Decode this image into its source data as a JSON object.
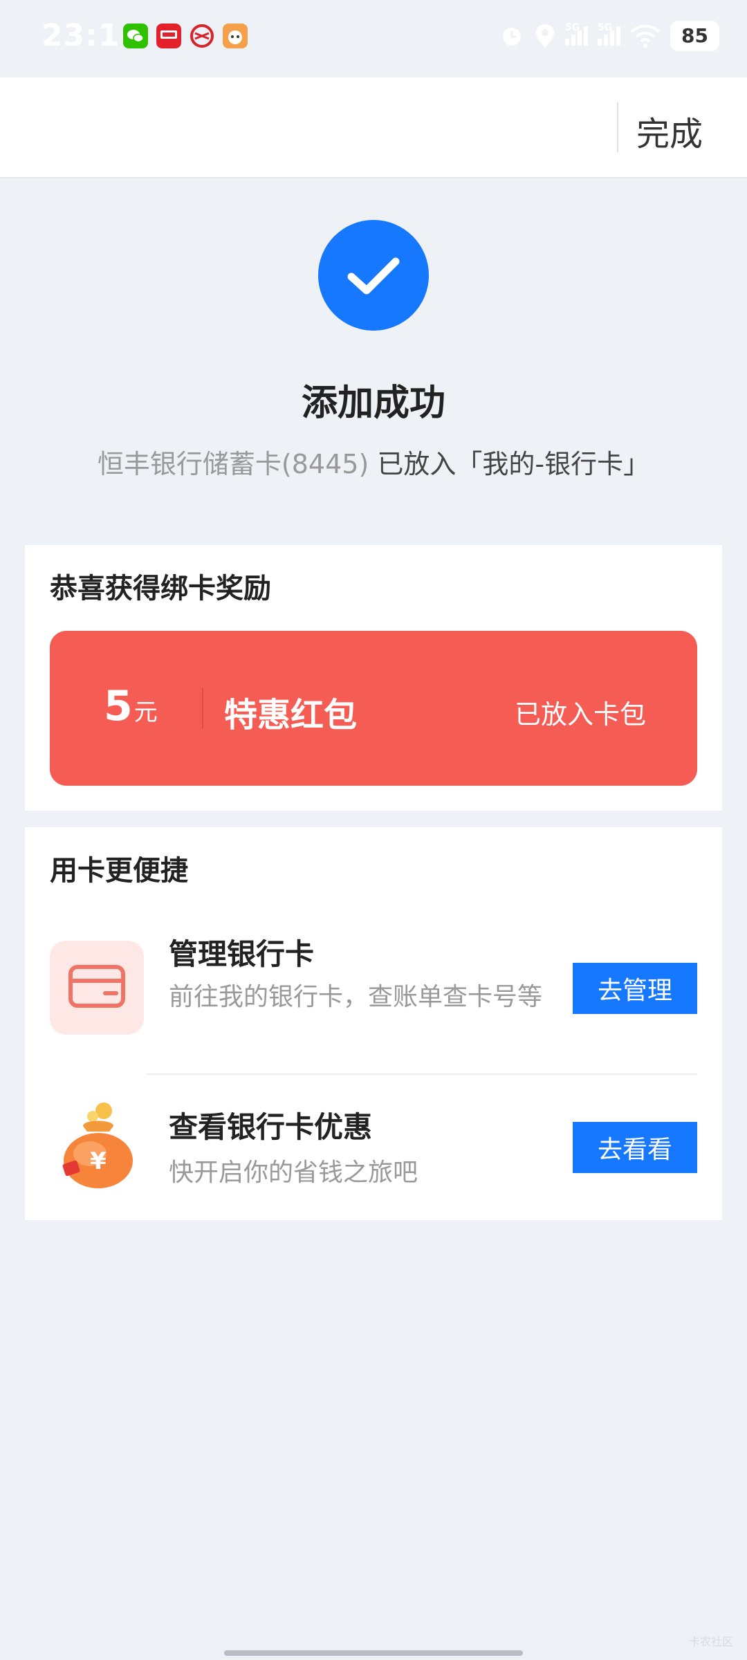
{
  "status_bar": {
    "time": "23:16",
    "battery": "85",
    "network_1": "5G",
    "network_2": "5G",
    "notification_icons": [
      "wechat-icon",
      "unionpay-app-icon",
      "bank-app-icon",
      "pet-app-icon"
    ]
  },
  "header": {
    "done_label": "完成"
  },
  "success": {
    "title": "添加成功",
    "card_name": "恒丰银行储蓄卡(8445)",
    "placed_text": "已放入「我的-银行卡」",
    "accent_color": "#1677ff"
  },
  "reward": {
    "section_title": "恭喜获得绑卡奖励",
    "amount": "5",
    "unit": "元",
    "name": "特惠红包",
    "status": "已放入卡包",
    "color": "#f45c54"
  },
  "convenience": {
    "section_title": "用卡更便捷",
    "items": [
      {
        "title": "管理银行卡",
        "desc": "前往我的银行卡，查账单查卡号等",
        "button": "去管理",
        "icon": "bank-card-icon"
      },
      {
        "title": "查看银行卡优惠",
        "desc": "快开启你的省钱之旅吧",
        "button": "去看看",
        "icon": "money-bag-icon"
      }
    ]
  },
  "watermark": "卡农社区"
}
